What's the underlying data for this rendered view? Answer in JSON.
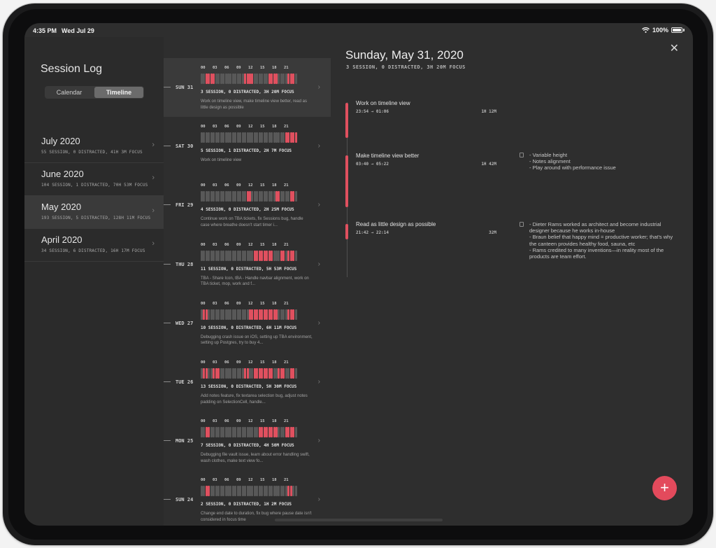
{
  "status": {
    "time": "4:35 PM",
    "date": "Wed Jul 29",
    "battery": "100%"
  },
  "sidebar": {
    "title": "Session Log",
    "segments": [
      "Calendar",
      "Timeline"
    ],
    "active_segment": "Timeline",
    "months": [
      {
        "name": "July 2020",
        "stats": "55 SESSION, 0 DISTRACTED, 41H 3M FOCUS"
      },
      {
        "name": "June 2020",
        "stats": "104 SESSION, 1 DISTRACTED, 70H 53M FOCUS"
      },
      {
        "name": "May 2020",
        "stats": "193 SESSION, 5 DISTRACTED, 128H 11M FOCUS",
        "selected": true
      },
      {
        "name": "April 2020",
        "stats": "34 SESSION, 6 DISTRACTED, 16H 17M FOCUS"
      }
    ]
  },
  "hour_labels": [
    "00",
    "03",
    "06",
    "09",
    "12",
    "15",
    "18",
    "21"
  ],
  "days": [
    {
      "label": "SUN 31",
      "stats": "3 SESSION, 0 DISTRACTED, 3H 20M FOCUS",
      "desc": "Work on timeline view, make timeline view better, read as little design as possible",
      "active_slots": [
        2,
        3,
        4,
        5,
        18,
        19,
        20,
        21,
        28,
        29,
        30,
        31,
        36,
        37,
        38
      ],
      "selected": true
    },
    {
      "label": "SAT 30",
      "stats": "5 SESSION, 1 DISTRACTED, 2H 7M FOCUS",
      "desc": "Work on timeline view",
      "active_slots": [
        35,
        36,
        37,
        38,
        39
      ]
    },
    {
      "label": "FRI 29",
      "stats": "4 SESSION, 0 DISTRACTED, 2H 25M FOCUS",
      "desc": "Continue work on TBA tickets, fix Sessions bug, handle case where breathe doesn't start timer i...",
      "active_slots": [
        19,
        20,
        31,
        32,
        37,
        38
      ]
    },
    {
      "label": "THU 28",
      "stats": "11 SESSION, 0 DISTRACTED, 5H 53M FOCUS",
      "desc": "TBA - Share Icon, tBA - Handle navbar alignment, work on TBA ticket, mop, work and f...",
      "active_slots": [
        22,
        23,
        24,
        25,
        26,
        27,
        28,
        29,
        33,
        34,
        36,
        37,
        38
      ]
    },
    {
      "label": "WED 27",
      "stats": "10 SESSION, 0 DISTRACTED, 6H 11M FOCUS",
      "desc": "Debugging crash issue on iOS, setting up TBA environment, setting up Postgres, try to buy 4...",
      "active_slots": [
        1,
        2,
        20,
        21,
        22,
        23,
        24,
        25,
        26,
        27,
        28,
        29,
        30,
        31,
        36,
        37,
        38
      ]
    },
    {
      "label": "TUE 26",
      "stats": "13 SESSION, 0 DISTRACTED, 5H 30M FOCUS",
      "desc": "Add notes feature, fix textarea selection bug, adjust notes padding on SelectionCell, handle...",
      "active_slots": [
        1,
        2,
        5,
        6,
        7,
        18,
        19,
        22,
        23,
        24,
        25,
        26,
        27,
        28,
        29,
        32,
        33,
        34,
        37,
        38
      ]
    },
    {
      "label": "MON 25",
      "stats": "7 SESSION, 0 DISTRACTED, 4H 50M FOCUS",
      "desc": "Debugging file vault issue, learn about error handling swift, wash clothes, make text view fo...",
      "active_slots": [
        2,
        3,
        24,
        25,
        26,
        27,
        28,
        29,
        30,
        31,
        35,
        36,
        37,
        38
      ]
    },
    {
      "label": "SUN 24",
      "stats": "2 SESSION, 0 DISTRACTED, 1H 2M FOCUS",
      "desc": "Change end date to duration, fix bug where pause date isn't considered in focus time",
      "active_slots": [
        2,
        3,
        36,
        37
      ]
    }
  ],
  "detail": {
    "title": "Sunday, May 31, 2020",
    "subtitle": "3 SESSION, 0 DISTRACTED, 3H 20M FOCUS",
    "sessions": [
      {
        "title": "Work on timeline view",
        "time": "23:54 → 01:06",
        "duration": "1H 12M",
        "note": ""
      },
      {
        "title": "Make timeline view better",
        "time": "03:40 → 05:22",
        "duration": "1H 42M",
        "note": "- Variable height\n- Notes alignment\n- Play around with performance issue"
      },
      {
        "title": "Read as little design as possible",
        "time": "21:42 → 22:14",
        "duration": "32M",
        "note": "- Dieter Rams worked as architect and become industrial designer because he works in-house\n- Braun belief that happy mind = productive worker; that's why the canteen provides healthy food, sauna, etc\n- Rams credited to many inventions—in reality most of the products are team effort."
      }
    ]
  },
  "icons": {
    "close": "close-icon",
    "add": "plus-icon",
    "chevron": "chevron-right-icon",
    "note": "document-icon"
  },
  "colors": {
    "accent": "#e0505f",
    "fab": "#e34a5c",
    "background": "#2e2e2e"
  }
}
